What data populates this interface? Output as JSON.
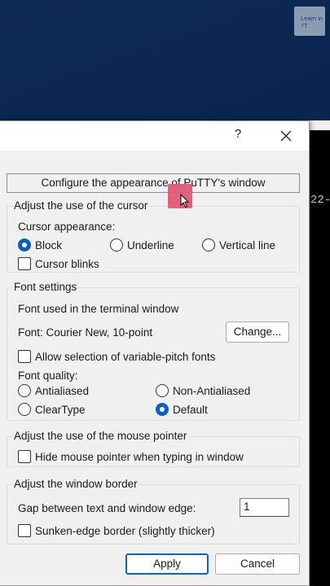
{
  "desktop": {
    "badge_text": "Learn in 7T"
  },
  "terminal": {
    "visible_text": "22-"
  },
  "dialog": {
    "help_glyph": "?",
    "banner": "Configure the appearance of PuTTY's window",
    "cursor": {
      "title": "Adjust the use of the cursor",
      "appearance_label": "Cursor appearance:",
      "options": [
        "Block",
        "Underline",
        "Vertical line"
      ],
      "selected": "Block",
      "blinks_label": "Cursor blinks",
      "blinks_checked": false
    },
    "font": {
      "title": "Font settings",
      "used_label": "Font used in the terminal window",
      "current_font": "Font: Courier New, 10-point",
      "change_button": "Change...",
      "variable_pitch_label": "Allow selection of variable-pitch fonts",
      "variable_pitch_checked": false,
      "quality_label": "Font quality:",
      "quality_options": [
        "Antialiased",
        "Non-Antialiased",
        "ClearType",
        "Default"
      ],
      "quality_selected": "Default"
    },
    "mouse": {
      "title": "Adjust the use of the mouse pointer",
      "hide_label": "Hide mouse pointer when typing in window",
      "hide_checked": false
    },
    "border": {
      "title": "Adjust the window border",
      "gap_label": "Gap between text and window edge:",
      "gap_value": "1",
      "sunken_label": "Sunken-edge border (slightly thicker)",
      "sunken_checked": false
    },
    "apply_button": "Apply",
    "cancel_button": "Cancel"
  },
  "colors": {
    "accent": "#0a5fc4",
    "click_highlight": "#e05876"
  }
}
